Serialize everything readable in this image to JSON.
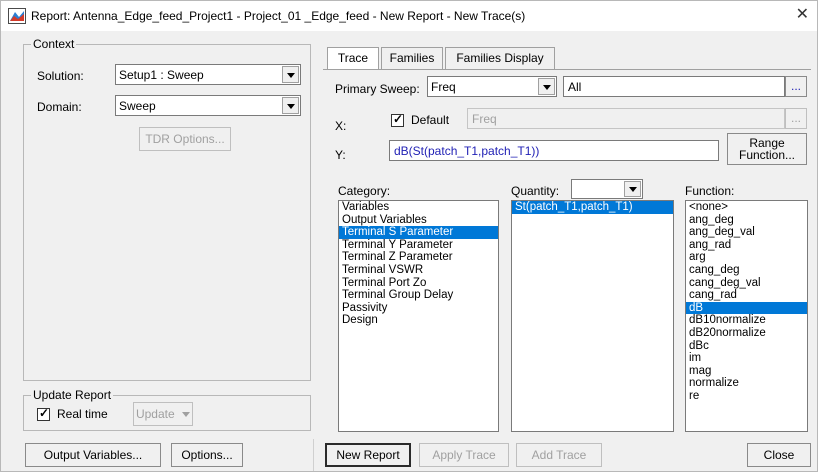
{
  "window": {
    "title": "Report: Antenna_Edge_feed_Project1 - Project_01 _Edge_feed - New Report - New Trace(s)",
    "close_glyph": "✕"
  },
  "context": {
    "legend": "Context",
    "solution_label": "Solution:",
    "solution_value": "Setup1 : Sweep",
    "domain_label": "Domain:",
    "domain_value": "Sweep",
    "tdr_button": "TDR Options..."
  },
  "update_report": {
    "legend": "Update Report",
    "realtime_label": "Real time",
    "update_button": "Update"
  },
  "bottom_left": {
    "output_variables_button": "Output Variables...",
    "options_button": "Options..."
  },
  "tabs": [
    "Trace",
    "Families",
    "Families Display"
  ],
  "trace": {
    "primary_sweep_label": "Primary Sweep:",
    "primary_sweep_value": "Freq",
    "primary_sweep_range": "All",
    "ellipsis": "...",
    "x_label": "X:",
    "x_default_label": "Default",
    "x_value": "Freq",
    "y_label": "Y:",
    "y_value": "dB(St(patch_T1,patch_T1))",
    "range_function_line1": "Range",
    "range_function_line2": "Function..."
  },
  "category": {
    "label": "Category:",
    "items": [
      "Variables",
      "Output Variables",
      "Terminal S Parameter",
      "Terminal Y Parameter",
      "Terminal Z Parameter",
      "Terminal VSWR",
      "Terminal Port Zo",
      "Terminal Group Delay",
      "Passivity",
      "Design"
    ],
    "selected_index": 2
  },
  "quantity": {
    "label": "Quantity:",
    "filter_value": "",
    "items": [
      "St(patch_T1,patch_T1)"
    ],
    "selected_index": 0
  },
  "function": {
    "label": "Function:",
    "items": [
      "<none>",
      "ang_deg",
      "ang_deg_val",
      "ang_rad",
      "arg",
      "cang_deg",
      "cang_deg_val",
      "cang_rad",
      "dB",
      "dB10normalize",
      "dB20normalize",
      "dBc",
      "im",
      "mag",
      "normalize",
      "re"
    ],
    "selected_index": 8
  },
  "bottom_right": {
    "new_report_button": "New Report",
    "apply_trace_button": "Apply Trace",
    "add_trace_button": "Add Trace",
    "close_button": "Close"
  },
  "colors": {
    "selection": "#0078d7",
    "y_text": "#1f1fb4"
  }
}
